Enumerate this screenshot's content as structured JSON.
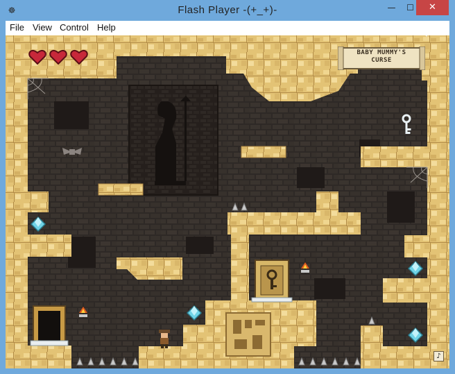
{
  "window": {
    "title": "Flash Player  -(+_+)-",
    "controls": {
      "minimize": "—",
      "maximize": "☐",
      "close": "✕"
    }
  },
  "menu": {
    "file": "File",
    "view": "View",
    "control": "Control",
    "help": "Help"
  },
  "hud": {
    "hearts_total": 3,
    "hearts_filled": 3,
    "title_line1": "BABY MUMMY'S",
    "title_line2": "CURSE",
    "sound_icon": "♪"
  },
  "colors": {
    "sandstone": "#e3c375",
    "sandstone_light": "#f3dc9c",
    "sandstone_dark": "#b18a46",
    "wall": "#2e2926",
    "brick": "#3a342f",
    "heart": "#c7283a",
    "gem": "#6fd3e6",
    "spike": "#c9c9c9",
    "titlebar": "#6fa9dc",
    "close_button": "#c74545"
  },
  "icons": {
    "app": "flash-player-icon",
    "hearts": "heart-icon",
    "key": "key-icon",
    "gem": "diamond-gem-icon",
    "bat": "bat-icon",
    "torch": "torch-icon",
    "spike": "spike-icon",
    "sound": "music-note-icon"
  }
}
